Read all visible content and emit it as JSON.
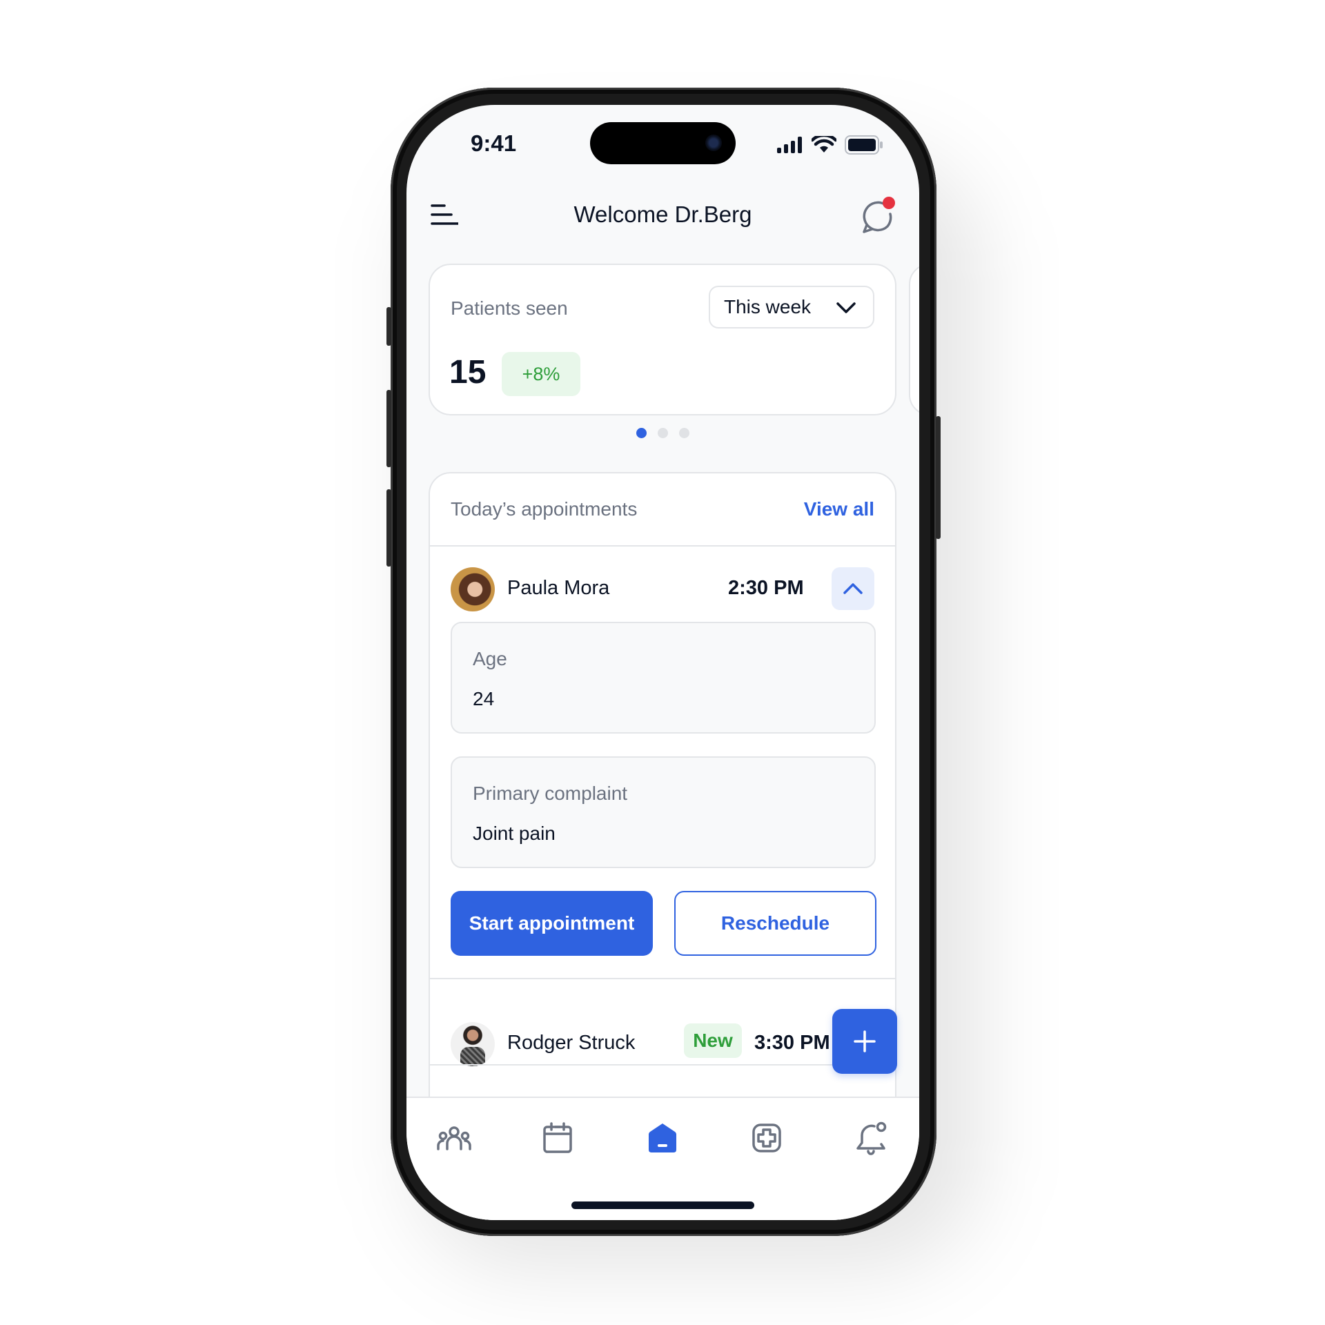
{
  "status_bar": {
    "time": "9:41",
    "icons": [
      "cellular-signal-icon",
      "wifi-icon",
      "battery-icon"
    ]
  },
  "header": {
    "title": "Welcome Dr.Berg",
    "left_icon": "menu-icon",
    "right_icon": "chat-icon",
    "has_notification": true
  },
  "stats_card": {
    "label": "Patients seen",
    "period": "This week",
    "value": "15",
    "change": "+8%",
    "carousel_pages": 3,
    "carousel_active_index": 0
  },
  "appointments": {
    "title": "Today’s appointments",
    "view_all_label": "View all",
    "items": [
      {
        "name": "Paula Mora",
        "time": "2:30 PM",
        "expanded": true,
        "details": [
          {
            "label": "Age",
            "value": "24"
          },
          {
            "label": "Primary complaint",
            "value": "Joint pain"
          }
        ],
        "actions": {
          "primary": "Start appointment",
          "secondary": "Reschedule"
        }
      },
      {
        "name": "Rodger Struck",
        "badge": "New",
        "time": "3:30 PM",
        "expanded": false
      }
    ]
  },
  "fab": {
    "icon": "plus-icon"
  },
  "tab_bar": {
    "tabs": [
      {
        "icon": "patients-icon",
        "active": false
      },
      {
        "icon": "calendar-icon",
        "active": false
      },
      {
        "icon": "home-icon",
        "active": true
      },
      {
        "icon": "medical-icon",
        "active": false
      },
      {
        "icon": "notifications-icon",
        "active": false
      }
    ]
  },
  "colors": {
    "accent": "#2f62e0",
    "success": "#2e9e3a",
    "success_bg": "#e8f7ea",
    "notification": "#e5323f",
    "text_primary": "#0b1324",
    "text_secondary": "#6b7280"
  }
}
